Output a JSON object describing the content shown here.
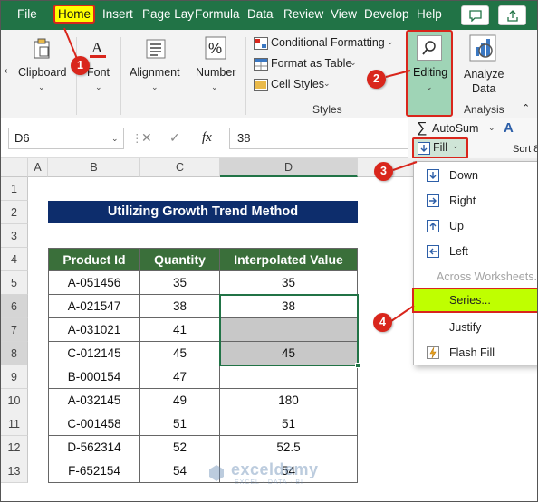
{
  "tabs": [
    "File",
    "Home",
    "Insert",
    "Page Lay",
    "Formula",
    "Data",
    "Review",
    "View",
    "Develop",
    "Help"
  ],
  "ribbon": {
    "clipboard": "Clipboard",
    "font": "Font",
    "alignment": "Alignment",
    "number": "Number",
    "conditional_formatting": "Conditional Formatting",
    "format_as_table": "Format as Table",
    "cell_styles": "Cell Styles",
    "styles_group": "Styles",
    "editing": "Editing",
    "analyze_data_1": "Analyze",
    "analyze_data_2": "Data",
    "analysis_group": "Analysis",
    "autosum": "AutoSum",
    "fill": "Fill",
    "sort_partial": "Sort 8"
  },
  "formula_bar": {
    "name_box": "D6",
    "fx": "fx",
    "value": "38"
  },
  "columns": [
    "A",
    "B",
    "C",
    "D"
  ],
  "rows": [
    "1",
    "2",
    "3",
    "4",
    "5",
    "6",
    "7",
    "8",
    "9",
    "10",
    "11",
    "12",
    "13"
  ],
  "sheet": {
    "title": "Utilizing Growth Trend Method",
    "headers": [
      "Product Id",
      "Quantity",
      "Interpolated Value"
    ],
    "data": [
      [
        "A-051456",
        "35",
        "35"
      ],
      [
        "A-021547",
        "38",
        "38"
      ],
      [
        "A-031021",
        "41",
        ""
      ],
      [
        "C-012145",
        "45",
        "45"
      ],
      [
        "B-000154",
        "47",
        ""
      ],
      [
        "A-032145",
        "49",
        "180"
      ],
      [
        "C-001458",
        "51",
        "51"
      ],
      [
        "D-562314",
        "52",
        "52.5"
      ],
      [
        "F-652154",
        "54",
        "54"
      ]
    ]
  },
  "fill_menu": [
    "Down",
    "Right",
    "Up",
    "Left",
    "Across Worksheets...",
    "Series...",
    "Justify",
    "Flash Fill"
  ],
  "steps": [
    "1",
    "2",
    "3",
    "4"
  ],
  "watermark": "exceldemy",
  "watermark_sub": "EXCEL · DATA · BI",
  "colors": {
    "excel_green": "#217346",
    "highlight_yellow": "#ffff00",
    "callout_red": "#d9261c",
    "series_highlight": "#bfff00",
    "table_header_green": "#3a6f3a",
    "title_navy": "#0d2d6c",
    "selected_gray": "#c8c8c8"
  }
}
